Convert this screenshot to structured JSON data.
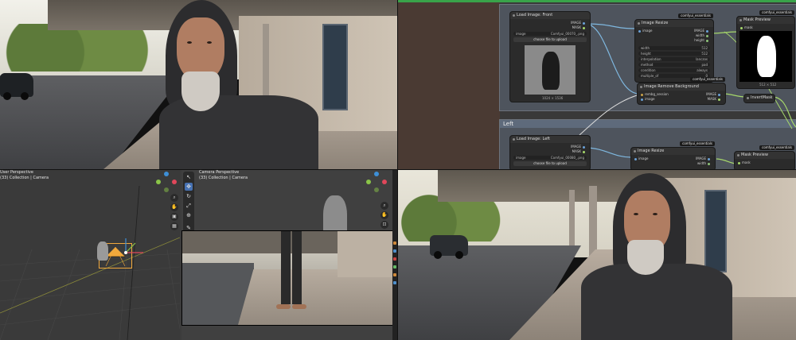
{
  "node_editor": {
    "groups": [
      {
        "label": ""
      },
      {
        "label": "Left"
      }
    ],
    "nodes": {
      "load_front": {
        "title": "Load Image: Front",
        "outputs": [
          "IMAGE",
          "MASK"
        ],
        "image_label": "image",
        "image_value": "Comfyui_00070_.png",
        "choose_button": "choose file to upload",
        "caption": "1024 × 1536"
      },
      "resize_1": {
        "title": "Image Resize",
        "badge": "comfyui_essentials",
        "input": "image",
        "outputs": [
          "IMAGE",
          "width",
          "height"
        ],
        "widgets": [
          {
            "label": "width",
            "value": "512"
          },
          {
            "label": "height",
            "value": "512"
          },
          {
            "label": "interpolation",
            "value": "lanczos"
          },
          {
            "label": "method",
            "value": "pad"
          },
          {
            "label": "condition",
            "value": "always"
          },
          {
            "label": "multiple_of",
            "value": "0"
          }
        ]
      },
      "mask_preview_1": {
        "title": "Mask Preview",
        "badge": "comfyui_essentials",
        "input": "mask",
        "caption": "512 × 512"
      },
      "remove_bg": {
        "title": "Image Remove Background",
        "badge": "comfyui_essentials",
        "inputs": [
          "rembg_session",
          "image"
        ],
        "outputs": [
          "IMAGE",
          "MASK"
        ]
      },
      "invert_mask": {
        "title": "InvertMask"
      },
      "load_left": {
        "title": "Load Image: Left",
        "outputs": [
          "IMAGE",
          "MASK"
        ],
        "image_label": "image",
        "image_value": "Comfyui_00080_.png",
        "choose_button": "choose file to upload"
      },
      "resize_2": {
        "title": "Image Resize",
        "badge": "comfyui_essentials",
        "input": "image",
        "outputs": [
          "IMAGE",
          "width"
        ]
      },
      "mask_preview_2": {
        "title": "Mask Preview",
        "badge": "comfyui_essentials",
        "input": "mask"
      }
    }
  },
  "blender": {
    "user_view": {
      "title": "User Perspective",
      "subtitle": "(33) Collection | Camera"
    },
    "camera_view": {
      "title": "Camera Perspective",
      "subtitle": "(33) Collection | Camera"
    },
    "gizmo_colors": {
      "x": "#e0475a",
      "y": "#8ac448",
      "z": "#3e8fd7"
    },
    "selection_color": "#f0a83c"
  },
  "icons": [
    "cursor-icon",
    "move-icon",
    "rotate-icon",
    "scale-icon",
    "transform-icon",
    "annotate-icon",
    "measure-icon",
    "zoom-icon",
    "hand-icon",
    "camera-icon",
    "grid-icon"
  ]
}
